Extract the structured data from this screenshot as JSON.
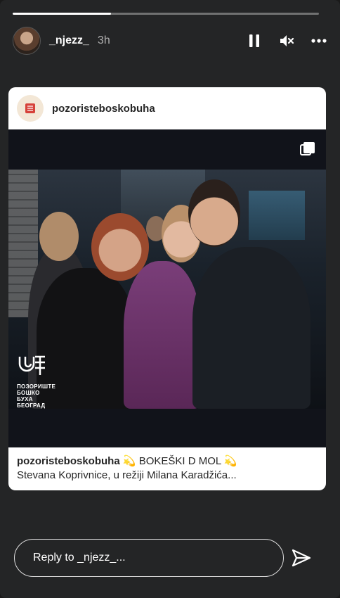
{
  "story": {
    "progress": 0.32,
    "username": "_njezz_",
    "time": "3h",
    "controls": {
      "pause": "pause-icon",
      "mute": "speaker-muted-icon",
      "more": "more-horizontal-icon"
    }
  },
  "post": {
    "username": "pozoristeboskobuha",
    "caption_user": "pozoristeboskobuha",
    "caption_text": "💫 BOKEŠKI D MOL 💫",
    "caption_line2": "Stevana Koprivnice, u režiji Milana Karadžića...",
    "logo_text": [
      "ПОЗОРИШТЕ",
      "БОШКО БУХА",
      "БЕОГРАД"
    ],
    "multi_icon": "multiple-images-icon"
  },
  "reply": {
    "placeholder": "Reply to _njezz_...",
    "send_icon": "send-icon"
  },
  "colors": {
    "background": "#242526",
    "card": "#ffffff",
    "media": "#11131a"
  }
}
